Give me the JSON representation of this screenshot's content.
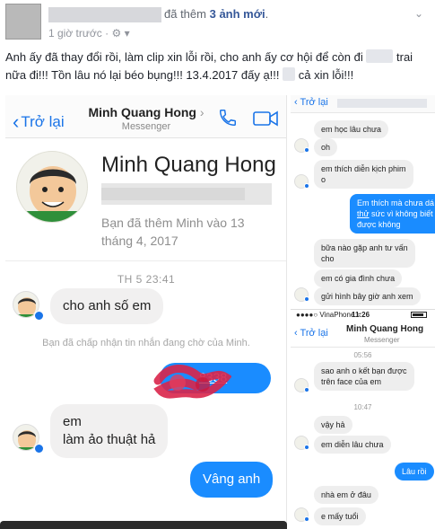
{
  "post": {
    "action_prefix": "đã thêm",
    "action_count": "3 ảnh mới",
    "action_suffix": ".",
    "time": "1 giờ trước",
    "caption_part1": "Anh ấy đã thay đổi rồi, làm clip xin lỗi rồi, cho anh ấy cơ hội để còn đi",
    "caption_part2": "trai nữa đi!!! Tồn lâu nó lại béo bụng!!! 13.4.2017 đấy ạ!!!",
    "caption_part3": "cả xin lỗi!!!"
  },
  "left_phone": {
    "nav": {
      "back": "Trở lại",
      "title": "Minh Quang Hong",
      "subtitle": "Messenger"
    },
    "profile": {
      "name": "Minh Quang Hong",
      "note": "Bạn đã thêm Minh vào 13 tháng 4, 2017"
    },
    "timestamp": "TH 5 23:41",
    "messages": {
      "m1": "cho anh số em",
      "notice": "Bạn đã chấp nhận tin nhắn đang chờ của Minh.",
      "phone_fragment": "8338",
      "m2_line1": "em",
      "m2_line2": "làm ảo thuật hả",
      "m3": "Vâng anh"
    }
  },
  "right_phone_top": {
    "nav": {
      "back": "Trở lại"
    },
    "messages": {
      "r1": "em học lâu chưa",
      "r2": "oh",
      "r3_line1": "em thích diễn kịch phim",
      "r3_line2": "o",
      "r4_line1": "Em thích mà chưa dá",
      "r4_line2_a": "thử",
      "r4_line2_b": " sức vì không biết",
      "r4_line3": "được không",
      "r5_line1": "bữa nào gặp anh tư vấn",
      "r5_line2": "cho",
      "r6": "em có gia đình chưa",
      "r7": "gửi hình bây giờ anh xem"
    }
  },
  "right_phone_bottom": {
    "status": {
      "carrier": "VinaPhone",
      "time": "11:26"
    },
    "nav": {
      "back": "Trở lại",
      "title": "Minh Quang Hong",
      "subtitle": "Messenger"
    },
    "time1": "05:56",
    "time2": "10:47",
    "messages": {
      "s1_line1": "sao anh o kết bạn được",
      "s1_line2": "trên face của em",
      "s2": "vậy hả",
      "s3": "em diễn lâu chưa",
      "s4": "Lâu rồi",
      "s5": "nhà em ở đâu",
      "s6": "e mấy tuổi"
    }
  },
  "colors": {
    "messenger_blue": "#1a8cff",
    "facebook_link": "#365899"
  }
}
